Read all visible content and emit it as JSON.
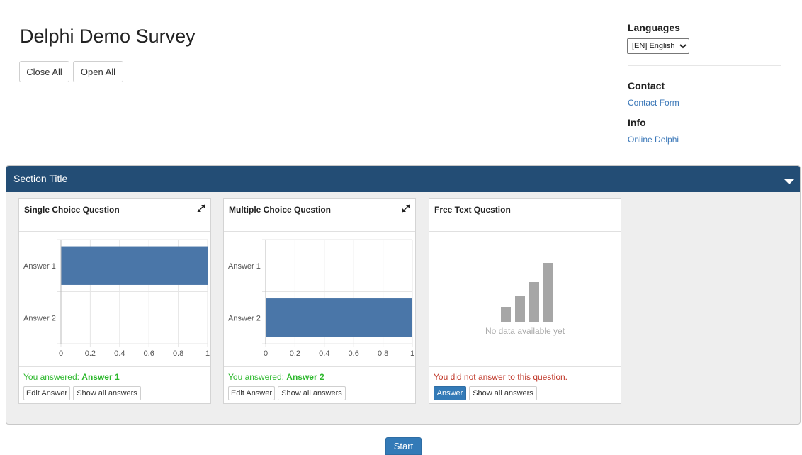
{
  "survey": {
    "title": "Delphi Demo Survey"
  },
  "toolbar": {
    "close_all": "Close All",
    "open_all": "Open All"
  },
  "sidebar": {
    "languages_heading": "Languages",
    "language_selected": "[EN] English",
    "contact_heading": "Contact",
    "contact_link": "Contact Form",
    "info_heading": "Info",
    "info_link": "Online Delphi"
  },
  "section": {
    "title": "Section Title"
  },
  "questions": [
    {
      "title": "Single Choice Question",
      "status_prefix": "You answered: ",
      "answer": "Answer 1",
      "edit_label": "Edit Answer",
      "show_all_label": "Show all answers"
    },
    {
      "title": "Multiple Choice Question",
      "status_prefix": "You answered: ",
      "answer": "Answer 2",
      "edit_label": "Edit Answer",
      "show_all_label": "Show all answers"
    },
    {
      "title": "Free Text Question",
      "no_data": "No data available yet",
      "status": "You did not answer to this question.",
      "answer_label": "Answer",
      "show_all_label": "Show all answers"
    }
  ],
  "footer": {
    "start_label": "Start"
  },
  "colors": {
    "section_header": "#234d75",
    "bar": "#4a76a8",
    "answered": "#2eb82e",
    "not_answered": "#c0392b",
    "primary": "#337ab7"
  },
  "chart_data": [
    {
      "type": "bar",
      "orientation": "horizontal",
      "categories": [
        "Answer 1",
        "Answer 2"
      ],
      "values": [
        1,
        0
      ],
      "xlim": [
        0,
        1
      ],
      "xticks": [
        "0",
        "0.2",
        "0.4",
        "0.6",
        "0.8",
        "1"
      ],
      "grid": true
    },
    {
      "type": "bar",
      "orientation": "horizontal",
      "categories": [
        "Answer 1",
        "Answer 2"
      ],
      "values": [
        0,
        1
      ],
      "xlim": [
        0,
        1
      ],
      "xticks": [
        "0",
        "0.2",
        "0.4",
        "0.6",
        "0.8",
        "1"
      ],
      "grid": true
    }
  ]
}
